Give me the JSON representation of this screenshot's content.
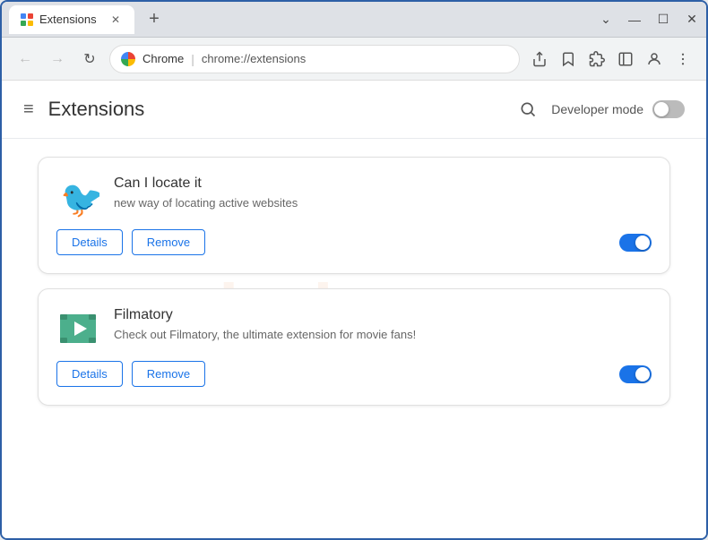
{
  "browser": {
    "title": "Extensions",
    "url_brand": "Chrome",
    "url_path": "chrome://extensions",
    "new_tab_label": "+"
  },
  "window_controls": {
    "minimize": "—",
    "maximize": "☐",
    "close": "✕",
    "chevron_down": "⌄"
  },
  "nav": {
    "back_disabled": true,
    "forward_disabled": true
  },
  "extensions_page": {
    "menu_icon": "≡",
    "title": "Extensions",
    "search_tooltip": "Search extensions",
    "developer_mode_label": "Developer mode"
  },
  "extensions": [
    {
      "id": "can-locate",
      "name": "Can I locate it",
      "description": "new way of locating active websites",
      "enabled": true,
      "details_label": "Details",
      "remove_label": "Remove"
    },
    {
      "id": "filmatory",
      "name": "Filmatory",
      "description": "Check out Filmatory, the ultimate extension for movie fans!",
      "enabled": true,
      "details_label": "Details",
      "remove_label": "Remove"
    }
  ],
  "watermark_text": "riash.com"
}
